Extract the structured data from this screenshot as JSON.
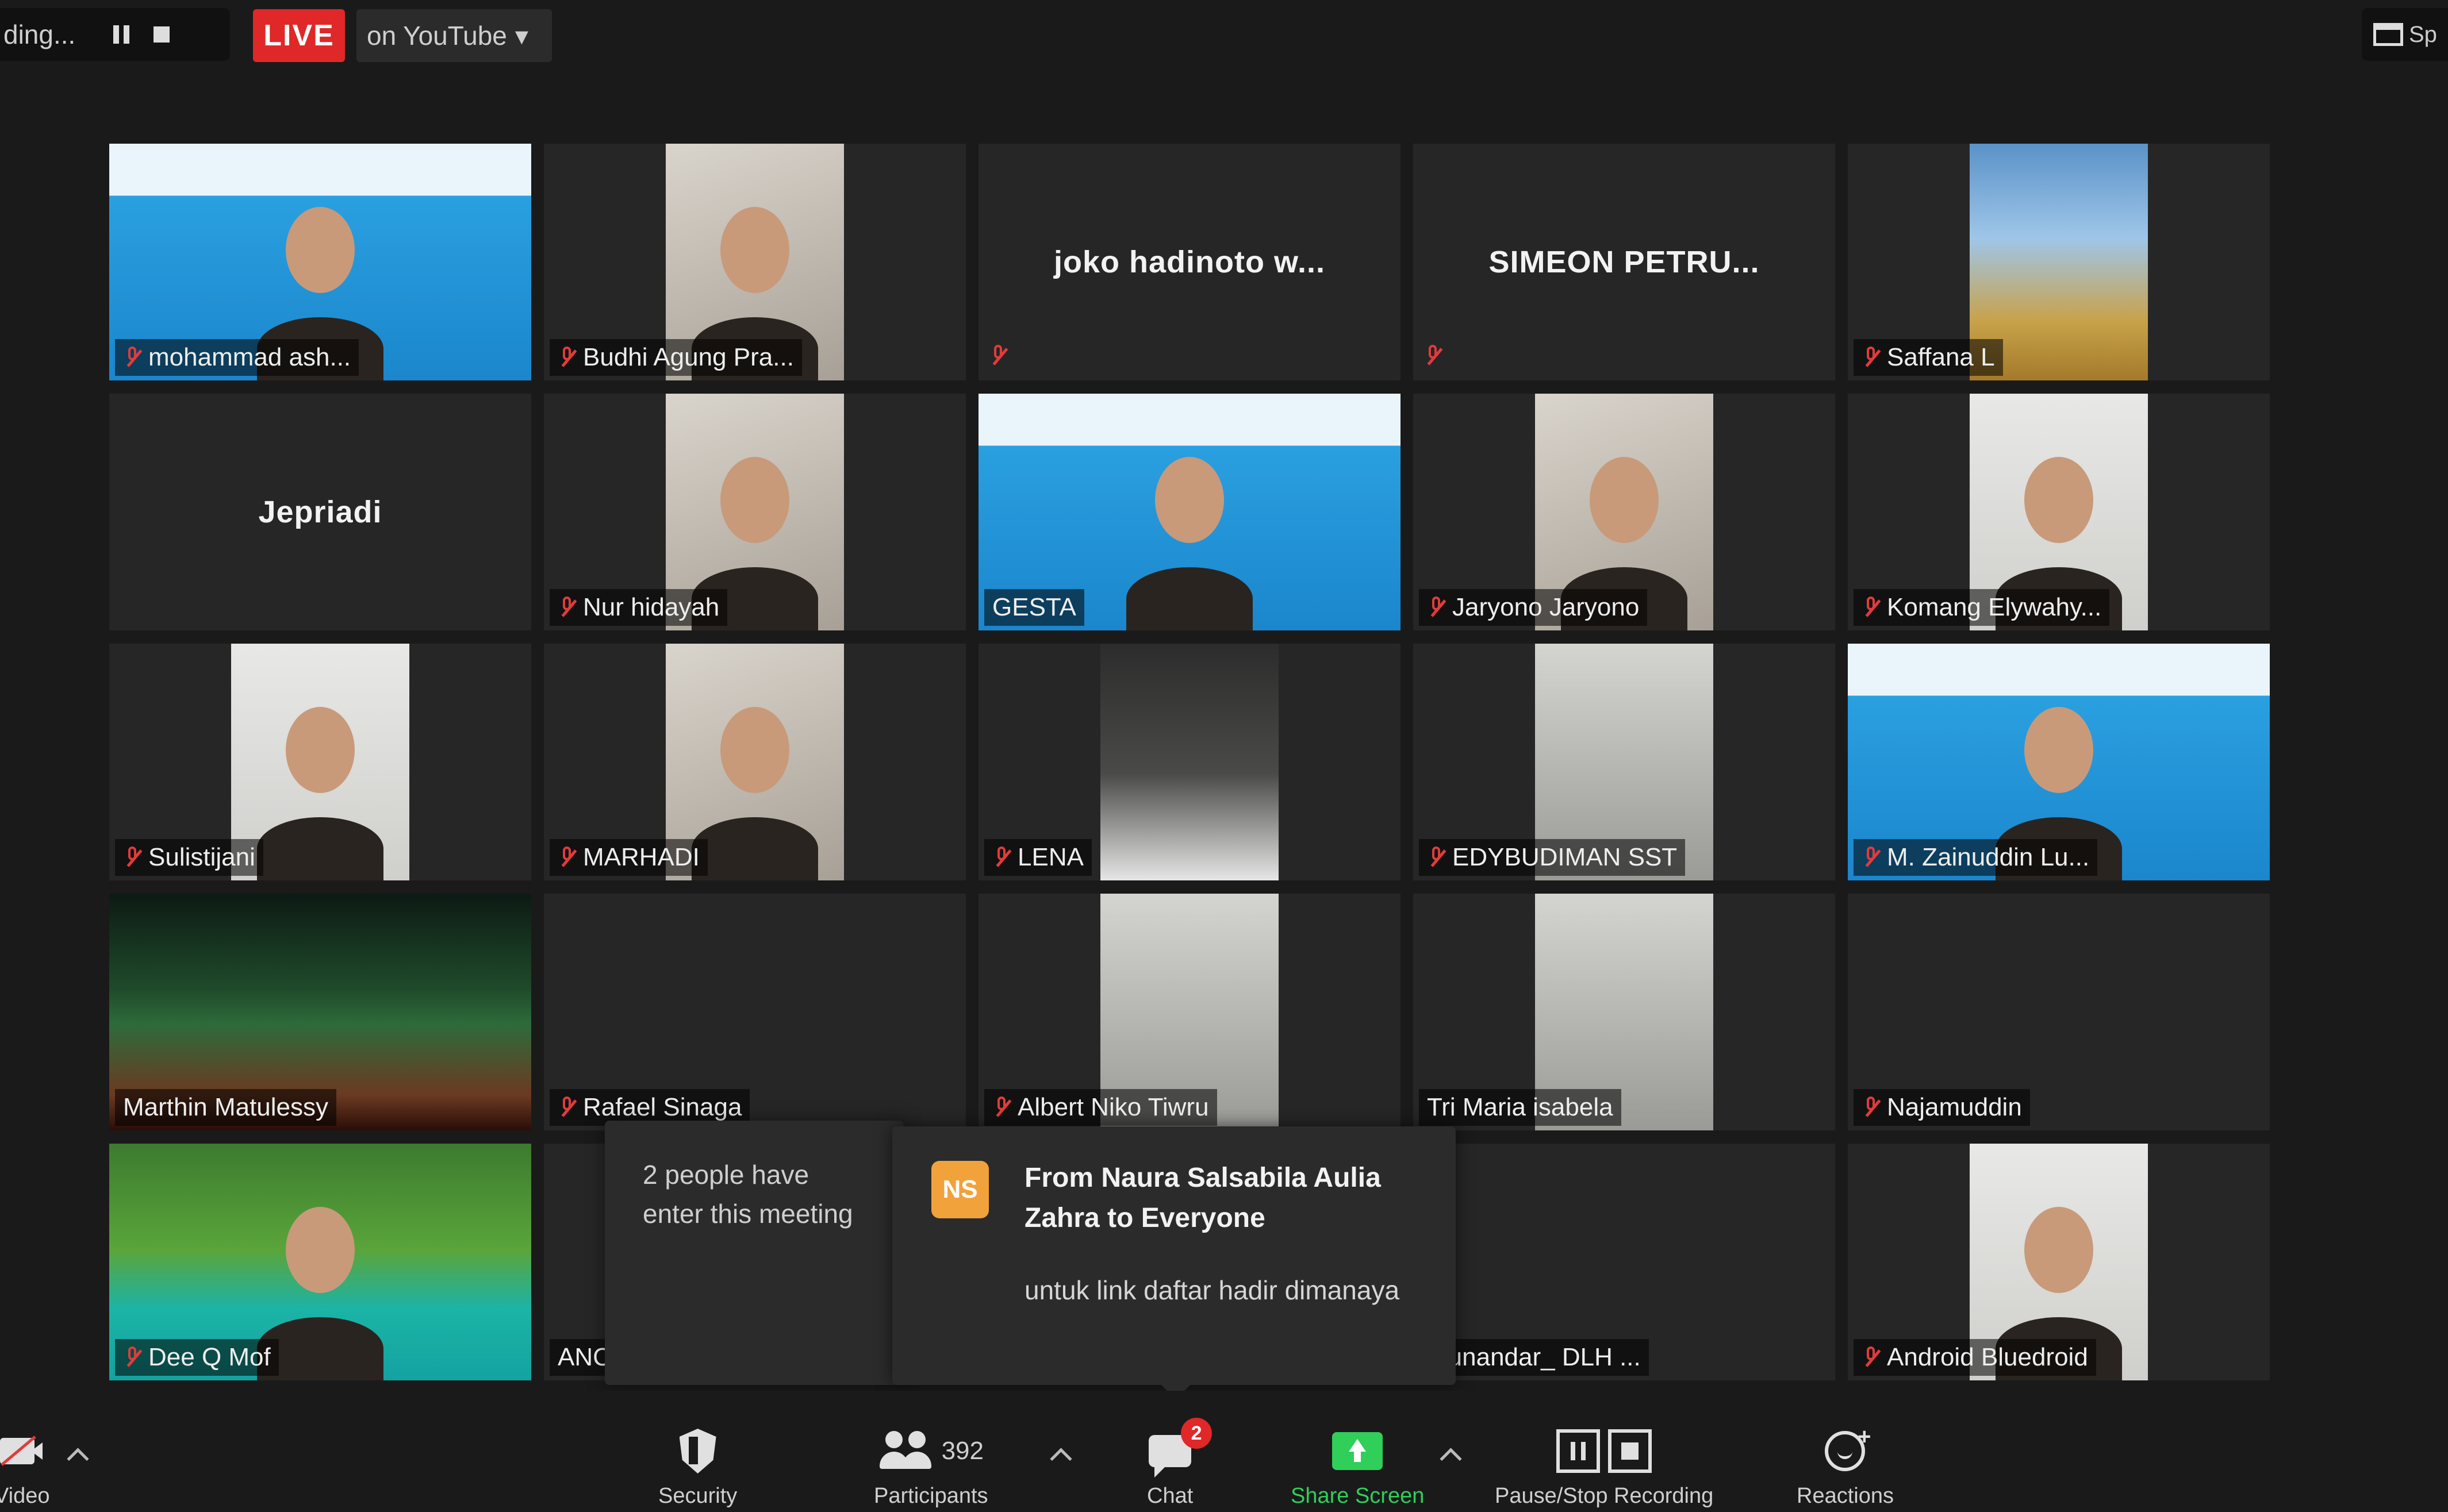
{
  "topbar": {
    "recording_text": "ding...",
    "live_label": "LIVE",
    "stream_target": "on YouTube",
    "view_label": "Sp"
  },
  "participants": [
    {
      "name": "mohammad ash...",
      "row": 0,
      "col": 0,
      "kind": "slide",
      "muted": true
    },
    {
      "name": "Budhi Agung Pra...",
      "row": 0,
      "col": 1,
      "kind": "person",
      "muted": true
    },
    {
      "name": "joko hadinoto w...",
      "row": 0,
      "col": 2,
      "kind": "text",
      "muted": true
    },
    {
      "name": "SIMEON PETRU...",
      "row": 0,
      "col": 3,
      "kind": "text",
      "muted": true
    },
    {
      "name": "Saffana L",
      "row": 0,
      "col": 4,
      "kind": "flowers",
      "muted": true
    },
    {
      "name": "Jepriadi",
      "row": 1,
      "col": 0,
      "kind": "text",
      "muted": false
    },
    {
      "name": "Nur hidayah",
      "row": 1,
      "col": 1,
      "kind": "room",
      "muted": true
    },
    {
      "name": "GESTA",
      "row": 1,
      "col": 2,
      "kind": "slide",
      "muted": false,
      "active": true
    },
    {
      "name": "Jaryono Jaryono",
      "row": 1,
      "col": 3,
      "kind": "person",
      "muted": true
    },
    {
      "name": "Komang Elywahy...",
      "row": 1,
      "col": 4,
      "kind": "wall",
      "muted": true
    },
    {
      "name": "Sulistijani",
      "row": 2,
      "col": 0,
      "kind": "wall",
      "muted": true
    },
    {
      "name": "MARHADI",
      "row": 2,
      "col": 1,
      "kind": "person",
      "muted": true
    },
    {
      "name": "LENA",
      "row": 2,
      "col": 2,
      "kind": "dark",
      "muted": true
    },
    {
      "name": "EDYBUDIMAN SST",
      "row": 2,
      "col": 3,
      "kind": "gray",
      "muted": true
    },
    {
      "name": "M. Zainuddin Lu...",
      "row": 2,
      "col": 4,
      "kind": "slide",
      "muted": true
    },
    {
      "name": "Marthin Matulessy",
      "row": 3,
      "col": 0,
      "kind": "aurora",
      "muted": false
    },
    {
      "name": "Rafael Sinaga",
      "row": 3,
      "col": 1,
      "kind": "blank",
      "muted": true
    },
    {
      "name": "Albert Niko Tiwru",
      "row": 3,
      "col": 2,
      "kind": "gray",
      "muted": true
    },
    {
      "name": "Tri Maria isabela",
      "row": 3,
      "col": 3,
      "kind": "gray",
      "muted": false
    },
    {
      "name": "Najamuddin",
      "row": 3,
      "col": 4,
      "kind": "blank",
      "muted": true
    },
    {
      "name": "Dee Q Mof",
      "row": 4,
      "col": 0,
      "kind": "forest",
      "muted": true
    },
    {
      "name": "ANC",
      "row": 4,
      "col": 1,
      "kind": "blank",
      "muted": false
    },
    {
      "name": "Munandar_ DLH ...",
      "row": 4,
      "col": 3,
      "kind": "blank",
      "muted": false
    },
    {
      "name": "Android Bluedroid",
      "row": 4,
      "col": 4,
      "kind": "wall",
      "muted": true
    }
  ],
  "notifications": {
    "join_text": "2 people have enter this meeting",
    "chat_avatar_initials": "NS",
    "chat_from": "From Naura Salsabila Aulia Zahra to Everyone",
    "chat_message": "untuk link daftar hadir dimanaya"
  },
  "toolbar": {
    "video_label": "Video",
    "security_label": "Security",
    "participants_label": "Participants",
    "participants_count": "392",
    "chat_label": "Chat",
    "chat_badge": "2",
    "share_label": "Share Screen",
    "recording_label": "Pause/Stop Recording",
    "reactions_label": "Reactions"
  },
  "colors": {
    "background": "#1a1a1a",
    "tile": "#262626",
    "live_red": "#e02828",
    "active_speaker": "#d8e23a",
    "share_green": "#2fcf5a",
    "avatar_orange": "#f2a23a",
    "mute_red": "#e23b3b"
  }
}
